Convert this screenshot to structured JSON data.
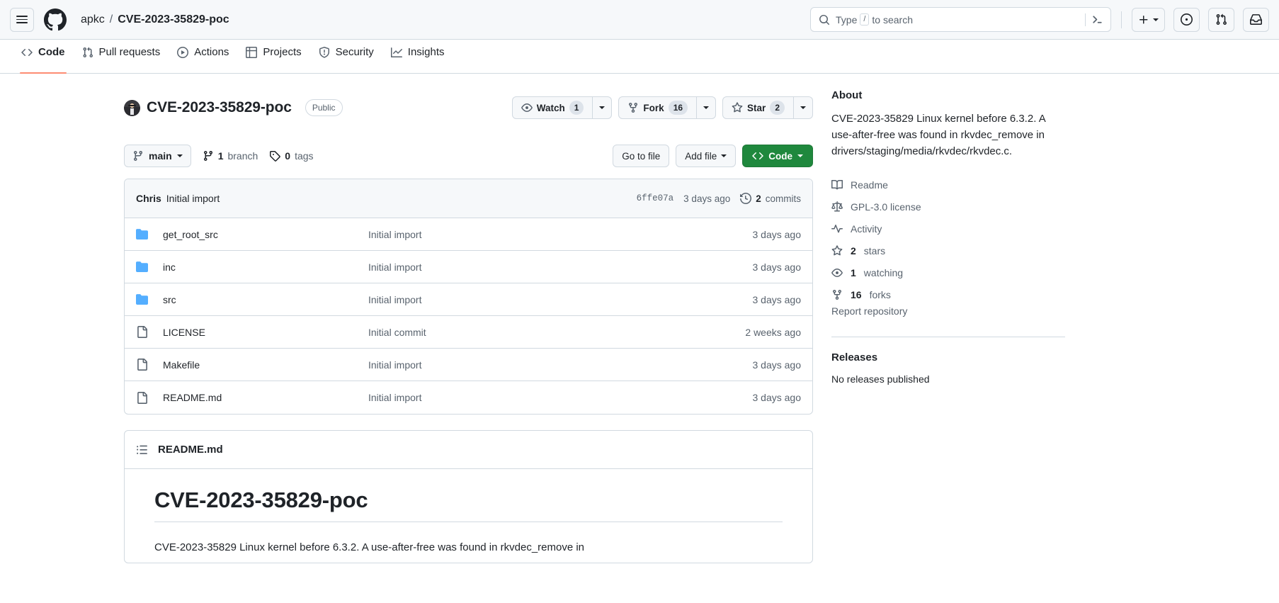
{
  "header": {
    "menu_icon": "hamburger-icon",
    "logo_icon": "github-logo-icon",
    "breadcrumb": {
      "owner": "apkc",
      "separator": "/",
      "repo": "CVE-2023-35829-poc"
    },
    "search": {
      "placeholder_prefix": "Type",
      "key_hint": "/",
      "placeholder_suffix": "to search",
      "search_icon": "search-icon",
      "cli_icon": "terminal-icon"
    },
    "actions": {
      "create_new_label": "",
      "plus_icon": "plus-icon",
      "issues_icon": "issue-opened-icon",
      "pull_requests_icon": "git-pull-request-icon",
      "inbox_icon": "inbox-icon"
    }
  },
  "repo_nav": {
    "tabs": [
      {
        "label": "Code",
        "icon": "code-icon",
        "active": true
      },
      {
        "label": "Pull requests",
        "icon": "git-pull-request-icon",
        "active": false
      },
      {
        "label": "Actions",
        "icon": "play-icon",
        "active": false
      },
      {
        "label": "Projects",
        "icon": "table-icon",
        "active": false
      },
      {
        "label": "Security",
        "icon": "shield-icon",
        "active": false
      },
      {
        "label": "Insights",
        "icon": "graph-icon",
        "active": false
      }
    ]
  },
  "repo_header": {
    "name": "CVE-2023-35829-poc",
    "visibility": "Public",
    "watch": {
      "label": "Watch",
      "count": "1",
      "icon": "eye-icon"
    },
    "fork": {
      "label": "Fork",
      "count": "16",
      "icon": "repo-forked-icon"
    },
    "star": {
      "label": "Star",
      "count": "2",
      "icon": "star-icon"
    }
  },
  "file_toolbar": {
    "branch": "main",
    "branch_icon": "git-branch-icon",
    "branches": {
      "count": "1",
      "label": "branch",
      "icon": "git-branch-icon"
    },
    "tags": {
      "count": "0",
      "label": "tags",
      "icon": "tag-icon"
    },
    "go_to_file": "Go to file",
    "add_file": "Add file",
    "code": "Code",
    "code_icon": "code-icon"
  },
  "commit_bar": {
    "author": "Chris",
    "message": "Initial import",
    "sha": "6ffe07a",
    "relative_time": "3 days ago",
    "commits_count": "2",
    "commits_label": "commits",
    "history_icon": "history-icon"
  },
  "files": [
    {
      "name": "get_root_src",
      "type": "folder",
      "message": "Initial import",
      "time": "3 days ago"
    },
    {
      "name": "inc",
      "type": "folder",
      "message": "Initial import",
      "time": "3 days ago"
    },
    {
      "name": "src",
      "type": "folder",
      "message": "Initial import",
      "time": "3 days ago"
    },
    {
      "name": "LICENSE",
      "type": "file",
      "message": "Initial commit",
      "time": "2 weeks ago"
    },
    {
      "name": "Makefile",
      "type": "file",
      "message": "Initial import",
      "time": "3 days ago"
    },
    {
      "name": "README.md",
      "type": "file",
      "message": "Initial import",
      "time": "3 days ago"
    }
  ],
  "readme": {
    "tab_label": "README.md",
    "list_icon": "list-unordered-icon",
    "heading": "CVE-2023-35829-poc",
    "paragraph": "CVE-2023-35829 Linux kernel before 6.3.2. A use-after-free was found in rkvdec_remove in"
  },
  "about": {
    "title": "About",
    "description": "CVE-2023-35829 Linux kernel before 6.3.2. A use-after-free was found in rkvdec_remove in drivers/staging/media/rkvdec/rkvdec.c.",
    "links": [
      {
        "label": "Readme",
        "icon": "book-icon",
        "bold": ""
      },
      {
        "label": "GPL-3.0 license",
        "icon": "law-icon",
        "bold": ""
      },
      {
        "label": "Activity",
        "icon": "pulse-icon",
        "bold": ""
      },
      {
        "label": "stars",
        "icon": "star-icon",
        "bold": "2"
      },
      {
        "label": "watching",
        "icon": "eye-icon",
        "bold": "1"
      },
      {
        "label": "forks",
        "icon": "repo-forked-icon",
        "bold": "16"
      }
    ],
    "report": "Report repository"
  },
  "releases": {
    "title": "Releases",
    "empty": "No releases published"
  },
  "colors": {
    "accent_green": "#1f883d",
    "tab_underline": "#fd8c73",
    "folder_blue": "#54aeff",
    "border": "#d1d9e0",
    "muted_text": "#59636e",
    "header_bg": "#f6f8fa"
  }
}
